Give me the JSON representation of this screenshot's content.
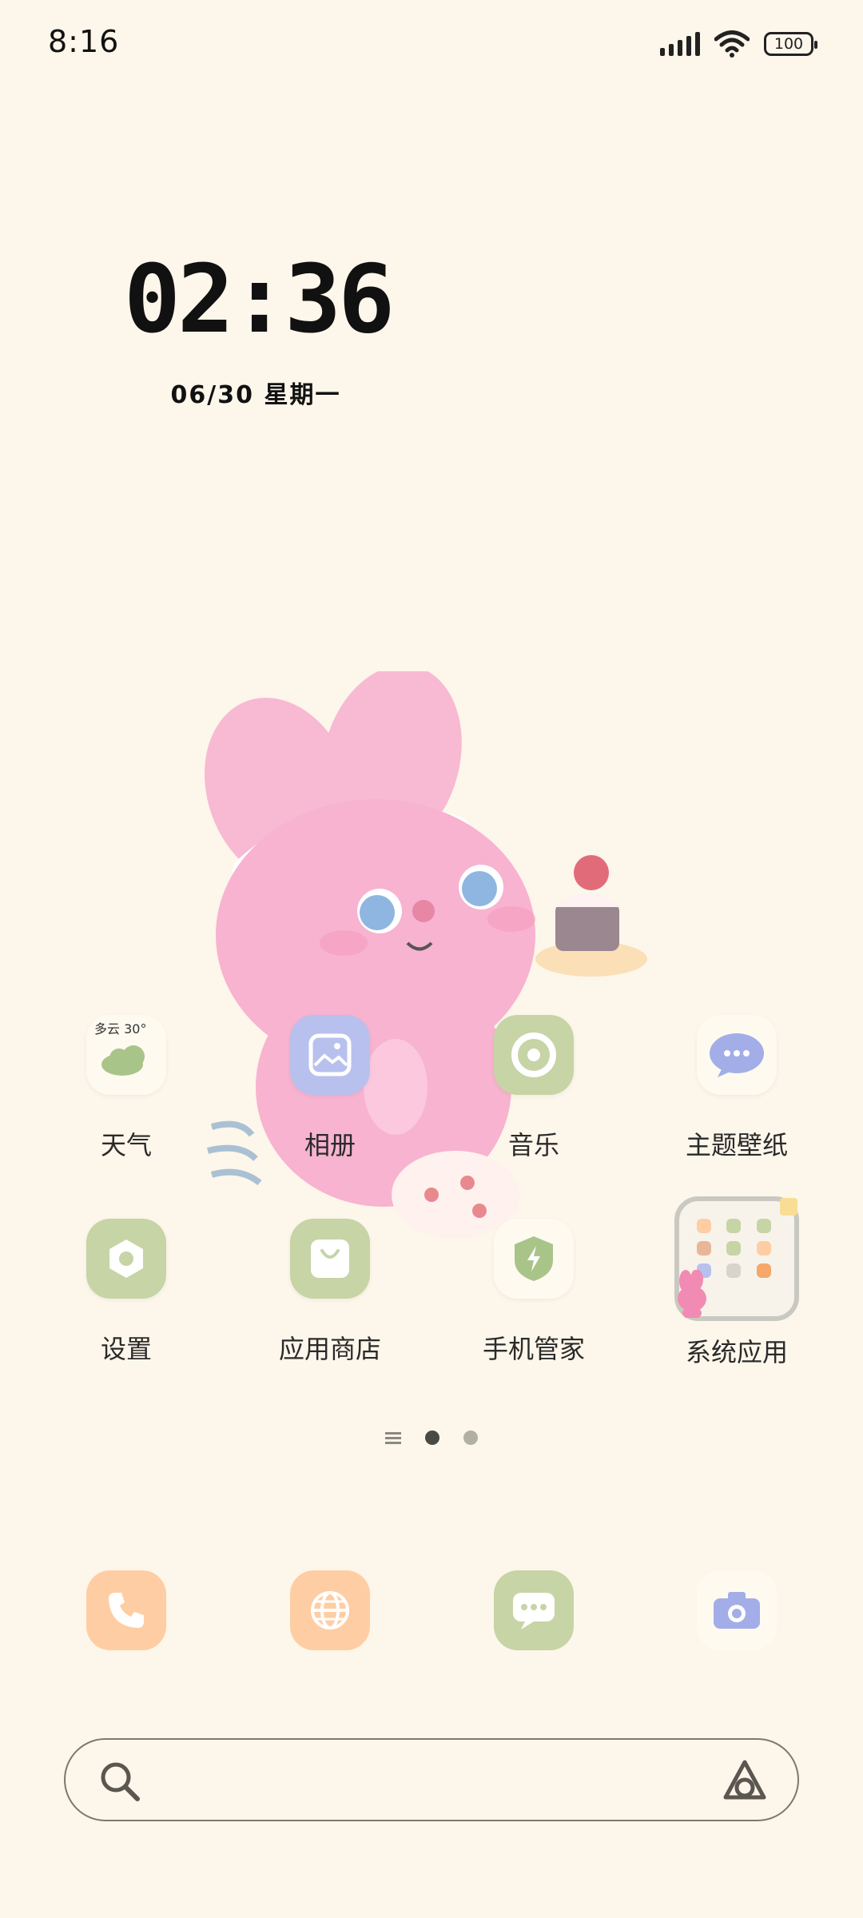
{
  "status_bar": {
    "time": "8:16",
    "battery": "100"
  },
  "clock_widget": {
    "time": "02:36",
    "date": "06/30 星期一"
  },
  "weather_icon_text": "多云 30°",
  "apps_row1": [
    {
      "label": "天气",
      "icon": "weather-icon",
      "color": "#fffaf0"
    },
    {
      "label": "相册",
      "icon": "gallery-icon",
      "color": "#b8c0ee"
    },
    {
      "label": "音乐",
      "icon": "music-icon",
      "color": "#c6d4a6"
    },
    {
      "label": "主题壁纸",
      "icon": "theme-icon",
      "color": "#fffaf0"
    }
  ],
  "apps_row2": [
    {
      "label": "设置",
      "icon": "settings-icon",
      "color": "#c6d4a6"
    },
    {
      "label": "应用商店",
      "icon": "app-store-icon",
      "color": "#c6d4a6"
    },
    {
      "label": "手机管家",
      "icon": "security-icon",
      "color": "#fffaf0"
    },
    {
      "label": "系统应用",
      "icon": "folder-icon",
      "color": "#f7f3ea"
    }
  ],
  "dock": [
    {
      "icon": "phone-icon",
      "color": "#ffcda3"
    },
    {
      "icon": "browser-icon",
      "color": "#ffcda3"
    },
    {
      "icon": "messages-icon",
      "color": "#c6d4a6"
    },
    {
      "icon": "camera-icon",
      "color": "#fffaf0"
    }
  ],
  "page_indicator": {
    "pages": 2,
    "active": 0
  }
}
